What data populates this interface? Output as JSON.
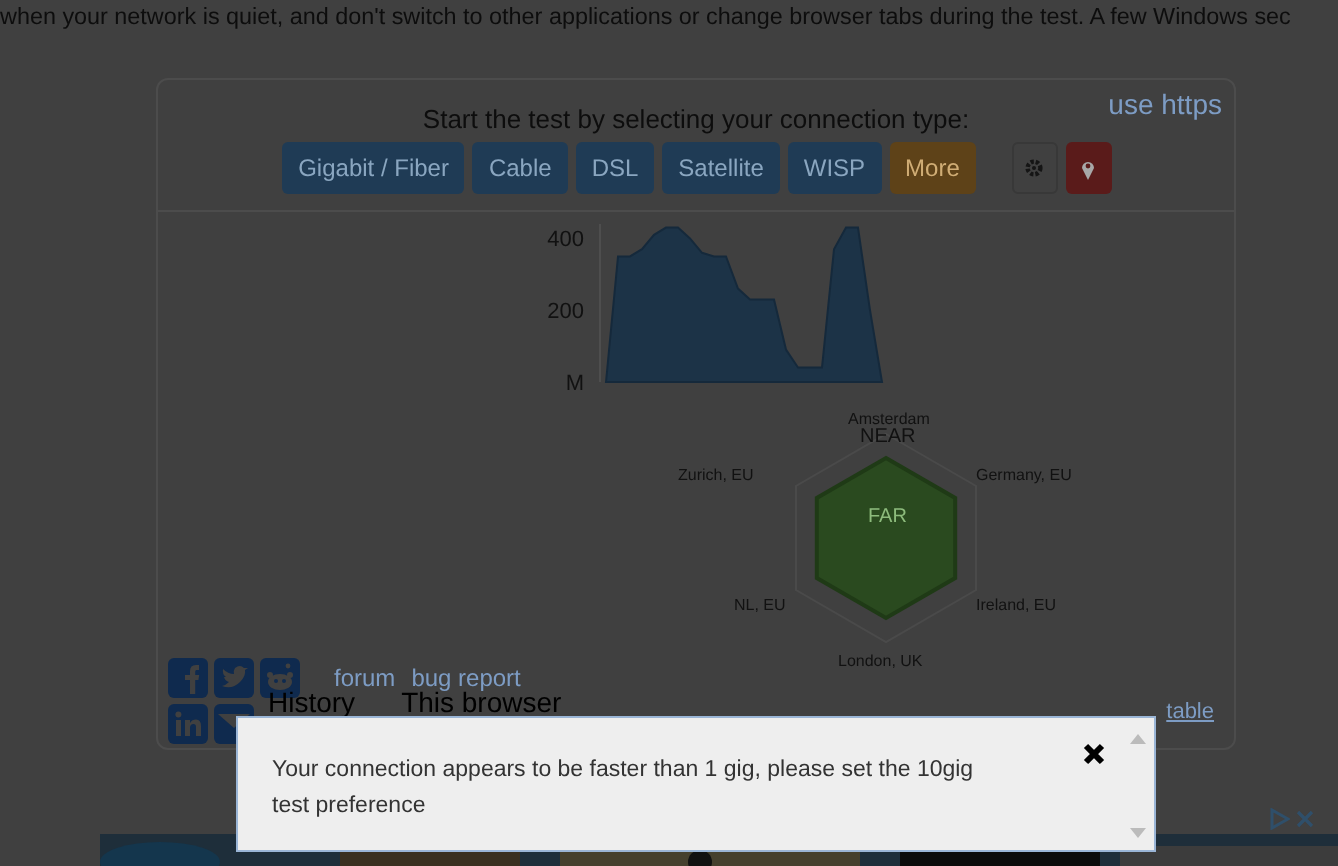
{
  "intro_text": "when your network is quiet, and don't switch to other applications or change browser tabs during the test. A few Windows sec",
  "panel": {
    "title": "Start the test by selecting your connection type:",
    "https_link": "use https",
    "connection_buttons": [
      {
        "label": "Gigabit / Fiber",
        "kind": "primary"
      },
      {
        "label": "Cable",
        "kind": "primary"
      },
      {
        "label": "DSL",
        "kind": "primary"
      },
      {
        "label": "Satellite",
        "kind": "primary"
      },
      {
        "label": "WISP",
        "kind": "primary"
      },
      {
        "label": "More",
        "kind": "warning"
      }
    ],
    "tool_buttons": [
      {
        "kind": "settings"
      },
      {
        "kind": "location"
      }
    ]
  },
  "speed_chart": {
    "chart_data": {
      "type": "area",
      "series": [
        {
          "color": "#1c3347",
          "values": [
            0,
            350,
            350,
            370,
            410,
            430,
            430,
            400,
            360,
            350,
            350,
            260,
            230,
            230,
            230,
            90,
            40,
            40,
            40,
            370,
            430,
            430,
            200,
            0
          ]
        }
      ],
      "ylim": [
        0,
        440
      ],
      "yticks": [
        {
          "value": 0,
          "label": "M"
        },
        200,
        400
      ]
    }
  },
  "server_map": {
    "labels": [
      "Amsterdam",
      "Zurich, EU",
      "Germany, EU",
      "NL, EU",
      "Ireland, EU",
      "London, UK"
    ],
    "near_label": "NEAR",
    "far_label": "FAR"
  },
  "social_links": [
    {
      "kind": "facebook"
    },
    {
      "kind": "twitter"
    },
    {
      "kind": "reddit"
    },
    {
      "kind": "linkedin"
    },
    {
      "kind": "email"
    }
  ],
  "links": [
    "forum",
    "bug report"
  ],
  "history_tabs": [
    "History",
    "This browser"
  ],
  "table_link": "table",
  "dialog": {
    "message": "Your connection appears to be faster than 1 gig, please set the 10gig test preference"
  }
}
